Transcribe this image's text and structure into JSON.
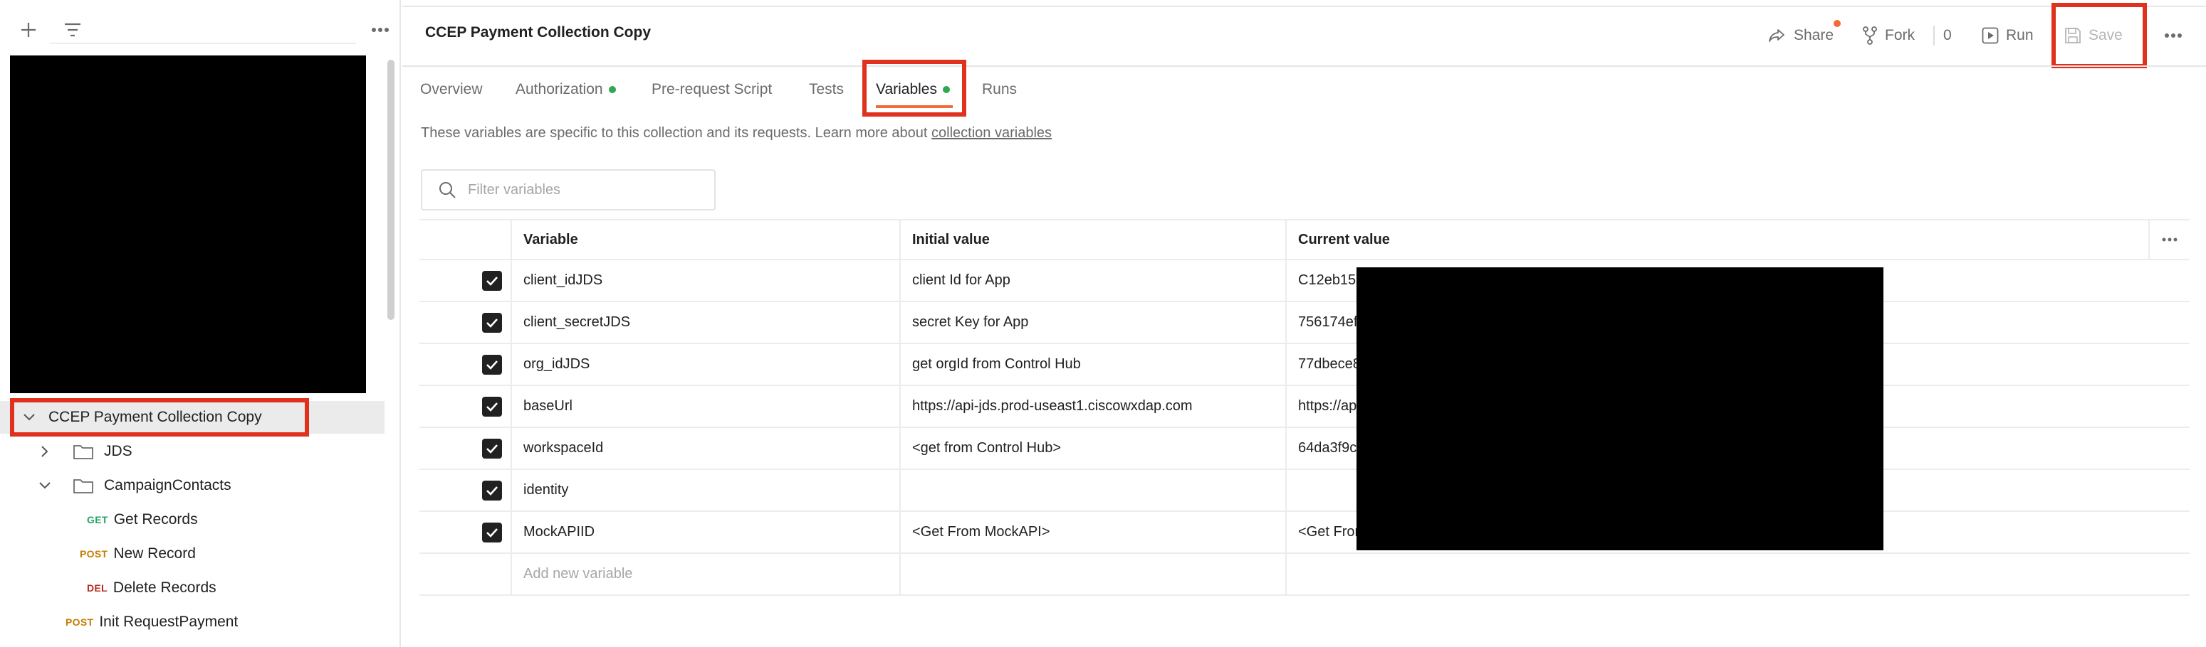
{
  "sidebar": {
    "toolbar": {
      "new_icon": "plus-icon",
      "filter_icon": "filter-icon",
      "more_icon": "more-horizontal-icon"
    },
    "tree": [
      {
        "label": "CCEP Payment Collection Copy",
        "type": "collection",
        "expanded": true
      },
      {
        "label": "JDS",
        "type": "folder",
        "expanded": false
      },
      {
        "label": "CampaignContacts",
        "type": "folder",
        "expanded": true
      },
      {
        "label": "Get Records",
        "type": "request",
        "method": "GET"
      },
      {
        "label": "New Record",
        "type": "request",
        "method": "POST"
      },
      {
        "label": "Delete Records",
        "type": "request",
        "method": "DEL"
      },
      {
        "label": "Init RequestPayment",
        "type": "request",
        "method": "POST"
      }
    ]
  },
  "header": {
    "title": "CCEP Payment Collection Copy",
    "actions": {
      "share": "Share",
      "fork": "Fork",
      "fork_count": "0",
      "run": "Run",
      "save": "Save"
    }
  },
  "tabs": [
    {
      "label": "Overview",
      "dot": false,
      "active": false
    },
    {
      "label": "Authorization",
      "dot": true,
      "active": false
    },
    {
      "label": "Pre-request Script",
      "dot": false,
      "active": false
    },
    {
      "label": "Tests",
      "dot": false,
      "active": false
    },
    {
      "label": "Variables",
      "dot": true,
      "active": true
    },
    {
      "label": "Runs",
      "dot": false,
      "active": false
    }
  ],
  "description": {
    "text": "These variables are specific to this collection and its requests. Learn more about",
    "link": "collection variables"
  },
  "filter": {
    "placeholder": "Filter variables"
  },
  "table": {
    "headers": {
      "variable": "Variable",
      "initial": "Initial value",
      "current": "Current value"
    },
    "rows": [
      {
        "checked": true,
        "variable": "client_idJDS",
        "initial": "client Id for App",
        "current": "C12eb15a"
      },
      {
        "checked": true,
        "variable": "client_secretJDS",
        "initial": "secret Key for App",
        "current": "756174ef"
      },
      {
        "checked": true,
        "variable": "org_idJDS",
        "initial": "get orgId from Control Hub",
        "current": "77dbece8"
      },
      {
        "checked": true,
        "variable": "baseUrl",
        "initial": "https://api-jds.prod-useast1.ciscowxdap.com",
        "current": "https://ap"
      },
      {
        "checked": true,
        "variable": "workspaceId",
        "initial": "<get from Control Hub>",
        "current": "64da3f9c"
      },
      {
        "checked": true,
        "variable": "identity",
        "initial": "",
        "current": ""
      },
      {
        "checked": true,
        "variable": "MockAPIID",
        "initial": "<Get From MockAPI>",
        "current": "<Get From"
      }
    ],
    "add_placeholder": "Add new variable"
  },
  "colors": {
    "accent": "#f26b3a",
    "highlight": "#e0301e",
    "status_dot": "#2fa84f",
    "get": "#26a269",
    "post": "#c47d00",
    "del": "#b52e1c"
  }
}
